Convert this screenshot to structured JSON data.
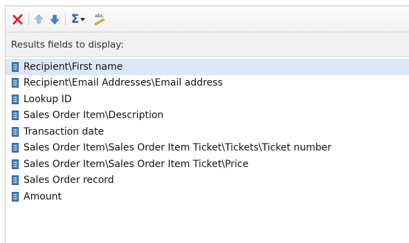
{
  "toolbar": {
    "buttons": [
      {
        "name": "delete",
        "icon": "delete-x-icon",
        "color": "#d9262b"
      },
      {
        "name": "move-up",
        "icon": "arrow-up-icon",
        "color": "#9fc1e6"
      },
      {
        "name": "move-down",
        "icon": "arrow-down-icon",
        "color": "#3d80cc"
      },
      {
        "name": "summarize",
        "icon": "sigma-icon",
        "color": "#2f5f99",
        "label": "Σ"
      },
      {
        "name": "spell-check",
        "icon": "spell-check-icon",
        "label": "abc"
      }
    ]
  },
  "header": {
    "label": "Results fields to display:"
  },
  "fields": [
    {
      "label": "Recipient\\First name",
      "selected": true
    },
    {
      "label": "Recipient\\Email Addresses\\Email address"
    },
    {
      "label": "Lookup ID"
    },
    {
      "label": "Sales Order Item\\Description"
    },
    {
      "label": "Transaction date"
    },
    {
      "label": "Sales Order Item\\Sales Order Item Ticket\\Tickets\\Ticket number"
    },
    {
      "label": "Sales Order Item\\Sales Order Item Ticket\\Price"
    },
    {
      "label": "Sales Order record"
    },
    {
      "label": "Amount"
    }
  ],
  "colors": {
    "selection": "#dce8f7",
    "field_icon": "#4a78b8"
  }
}
